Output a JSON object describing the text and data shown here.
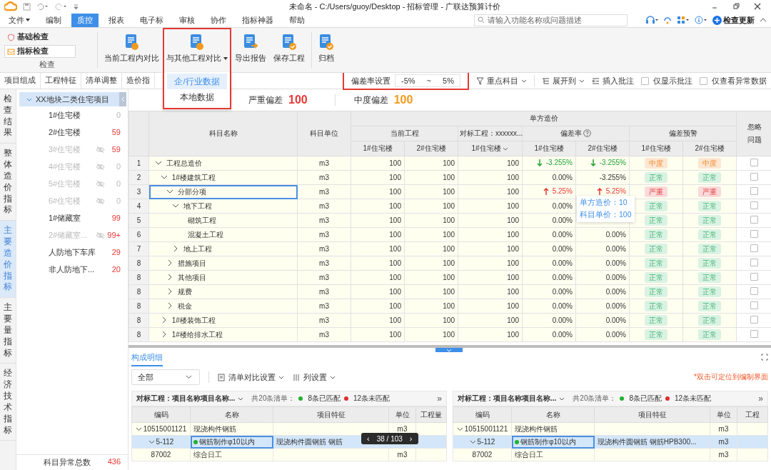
{
  "window": {
    "title": "未命名 - C:/Users/guoy/Desktop - 招标管理 - 广联达预算计价"
  },
  "menu": [
    {
      "label": "文件",
      "dropdown": true,
      "selected": false
    },
    {
      "label": "编制",
      "selected": false
    },
    {
      "label": "质控",
      "selected": true
    },
    {
      "label": "报表",
      "selected": false
    },
    {
      "label": "电子标",
      "selected": false
    },
    {
      "label": "审核",
      "selected": false
    },
    {
      "label": "协作",
      "selected": false
    },
    {
      "label": "指标神器",
      "selected": false
    },
    {
      "label": "帮助",
      "selected": false
    }
  ],
  "search": {
    "placeholder": "请输入功能名称或问题描述"
  },
  "update_button": "检查更新",
  "ribbon": {
    "check_group": {
      "caption": "检查",
      "items": [
        {
          "label": "基础检查",
          "selected": false
        },
        {
          "label": "指标检查",
          "selected": true
        }
      ]
    },
    "buttons": [
      {
        "label": "当前工程内对比"
      },
      {
        "label": "与其他工程对比",
        "dropdown": true,
        "highlighted": true
      },
      {
        "label": "导出报告"
      },
      {
        "label": "保存工程"
      },
      {
        "label": "归档"
      }
    ]
  },
  "compare_menu": {
    "items": [
      {
        "label": "企/行业数据",
        "selected": true
      },
      {
        "label": "本地数据",
        "selected": false
      }
    ]
  },
  "subtabs": [
    "项目组成",
    "工程特征",
    "清单调整",
    "造价指"
  ],
  "toolbar": {
    "deviation": {
      "label": "偏差率设置",
      "min": "-5%",
      "separator": "~",
      "max": "5%",
      "highlighted": true
    },
    "key_subjects": "重点科目",
    "expand_to": "展开到",
    "insert_note": "插入批注",
    "checks": [
      {
        "label": "仅显示批注",
        "checked": false
      },
      {
        "label": "仅查看异常数据",
        "checked": false
      }
    ]
  },
  "vtabs": [
    {
      "label": "检查结果",
      "selected": false
    },
    {
      "label": "整体造价指标",
      "selected": false
    },
    {
      "label": "主要造价指标",
      "selected": true
    },
    {
      "label": "主要量指标",
      "selected": false
    },
    {
      "label": "经济技术指标",
      "selected": false
    }
  ],
  "tree": {
    "root": {
      "label": "XX地块二类住宅项目",
      "expanded": true,
      "children": [
        {
          "label": "1#住宅楼",
          "count": "0",
          "hidden": false,
          "alert": false
        },
        {
          "label": "2#住宅楼",
          "count": "59",
          "hidden": false,
          "alert": true
        },
        {
          "label": "3#住宅楼",
          "count": "59",
          "hidden": true,
          "alert": true
        },
        {
          "label": "4#住宅楼",
          "count": "0",
          "hidden": true,
          "alert": false
        },
        {
          "label": "5#住宅楼",
          "count": "0",
          "hidden": true,
          "alert": false
        },
        {
          "label": "6#住宅楼",
          "count": "0",
          "hidden": true,
          "alert": false
        },
        {
          "label": "1#储藏室",
          "count": "99",
          "hidden": false,
          "alert": true
        },
        {
          "label": "2#储藏室...",
          "count": "99+",
          "hidden": true,
          "alert": true
        },
        {
          "label": "人防地下车库",
          "count": "29",
          "hidden": false,
          "alert": true
        },
        {
          "label": "非人防地下...",
          "count": "20",
          "hidden": false,
          "alert": true
        }
      ]
    },
    "footer": {
      "label": "科目异常总数",
      "count": "436"
    }
  },
  "summary": [
    {
      "label": "严重偏差",
      "value": "100",
      "kind": "severe"
    },
    {
      "label": "中度偏差",
      "value": "100",
      "kind": "moderate"
    }
  ],
  "table": {
    "columns": {
      "name": "科目名称",
      "unit": "科目单位",
      "group": "单方造价",
      "current": "当前工程",
      "benchmark": "对标工程：xxxxxx...",
      "deviation": "偏差率",
      "warning": "偏差预警",
      "ignore": "忽略问题",
      "current_buildings": [
        "1#住宅楼",
        "2#住宅楼"
      ],
      "benchmark_building": "1#住宅楼",
      "deviation_buildings": [
        "1#住宅楼",
        "2#住宅楼"
      ],
      "warning_buildings": [
        "1#住宅楼",
        "2#住宅楼"
      ]
    },
    "tooltip": {
      "lines": [
        "单方造价：10",
        "科目单价：100"
      ]
    },
    "rows": [
      {
        "no": "1",
        "name": "工程总造价",
        "unit": "m3",
        "current": [
          "100",
          "100"
        ],
        "benchmark": "100",
        "deviation": [
          {
            "text": "-3.255%",
            "kind": "down"
          },
          {
            "text": "-3.255%",
            "kind": "down"
          }
        ],
        "warning": [
          {
            "label": "中度",
            "kind": "moderate"
          },
          {
            "label": "中度",
            "kind": "moderate"
          }
        ],
        "ignored": false,
        "selected": false,
        "expanded": true,
        "children": [
          {
            "no": "2",
            "name": "1#楼建筑工程",
            "unit": "m3",
            "current": [
              "100",
              "100"
            ],
            "benchmark": "100",
            "deviation": [
              {
                "text": "0.00%",
                "kind": "none"
              },
              {
                "text": "-3.255%",
                "kind": "none"
              }
            ],
            "warning": [
              {
                "label": "正常",
                "kind": "normal"
              },
              {
                "label": "正常",
                "kind": "normal"
              }
            ],
            "ignored": false,
            "selected": false,
            "expanded": true,
            "children": [
              {
                "no": "3",
                "name": "分部分项",
                "unit": "m3",
                "current": [
                  "100",
                  "100"
                ],
                "benchmark": "100",
                "deviation": [
                  {
                    "text": "5.25%",
                    "kind": "up"
                  },
                  {
                    "text": "5.25%",
                    "kind": "up"
                  }
                ],
                "warning": [
                  {
                    "label": "严重",
                    "kind": "severe"
                  },
                  {
                    "label": "严重",
                    "kind": "severe"
                  }
                ],
                "ignored": false,
                "selected": true,
                "expanded": true,
                "children": [
                  {
                    "no": "4",
                    "name": "地下工程",
                    "unit": "m3",
                    "current": [
                      "100",
                      "100"
                    ],
                    "benchmark": "100",
                    "deviation": [
                      {
                        "text": "0.00%",
                        "kind": "none"
                      }
                    ],
                    "warning": [
                      {
                        "label": "正常",
                        "kind": "normal"
                      },
                      {
                        "label": "正常",
                        "kind": "normal"
                      }
                    ],
                    "ignored": false,
                    "selected": false,
                    "expanded": true,
                    "children": [
                      {
                        "no": "5",
                        "name": "砌筑工程",
                        "unit": "m3",
                        "current": [
                          "100",
                          "100"
                        ],
                        "benchmark": "100",
                        "deviation": [
                          {
                            "text": "0.00%",
                            "kind": "none"
                          }
                        ],
                        "warning": [
                          {
                            "label": "正常",
                            "kind": "normal"
                          },
                          {
                            "label": "正常",
                            "kind": "normal"
                          }
                        ],
                        "ignored": false,
                        "selected": false
                      },
                      {
                        "no": "6",
                        "name": "混凝土工程",
                        "unit": "m3",
                        "current": [
                          "100",
                          "100"
                        ],
                        "benchmark": "100",
                        "deviation": [
                          {
                            "text": "0.00%",
                            "kind": "none"
                          },
                          {
                            "text": "0.00%",
                            "kind": "none"
                          }
                        ],
                        "warning": [
                          {
                            "label": "正常",
                            "kind": "normal"
                          },
                          {
                            "label": "正常",
                            "kind": "normal"
                          }
                        ],
                        "ignored": false,
                        "selected": false
                      }
                    ]
                  },
                  {
                    "no": "7",
                    "name": "地上工程",
                    "unit": "m3",
                    "current": [
                      "100",
                      "100"
                    ],
                    "benchmark": "100",
                    "deviation": [
                      {
                        "text": "0.00%",
                        "kind": "none"
                      },
                      {
                        "text": "0.00%",
                        "kind": "none"
                      }
                    ],
                    "warning": [
                      {
                        "label": "正常",
                        "kind": "normal"
                      },
                      {
                        "label": "正常",
                        "kind": "normal"
                      }
                    ],
                    "ignored": false,
                    "selected": false,
                    "expanded": false
                  }
                ]
              },
              {
                "no": "8",
                "name": "措施项目",
                "unit": "m3",
                "current": [
                  "100",
                  "100"
                ],
                "benchmark": "100",
                "deviation": [
                  {
                    "text": "0.00%",
                    "kind": "none"
                  },
                  {
                    "text": "0.00%",
                    "kind": "none"
                  }
                ],
                "warning": [
                  {
                    "label": "正常",
                    "kind": "normal"
                  },
                  {
                    "label": "正常",
                    "kind": "normal"
                  }
                ],
                "ignored": false,
                "selected": false,
                "expanded": false
              },
              {
                "no": "8",
                "name": "其他项目",
                "unit": "m3",
                "current": [
                  "100",
                  "100"
                ],
                "benchmark": "100",
                "deviation": [
                  {
                    "text": "0.00%",
                    "kind": "none"
                  },
                  {
                    "text": "0.00%",
                    "kind": "none"
                  }
                ],
                "warning": [
                  {
                    "label": "正常",
                    "kind": "normal"
                  },
                  {
                    "label": "正常",
                    "kind": "normal"
                  }
                ],
                "ignored": false,
                "selected": false,
                "expanded": false
              },
              {
                "no": "8",
                "name": "规费",
                "unit": "m3",
                "current": [
                  "100",
                  "100"
                ],
                "benchmark": "100",
                "deviation": [
                  {
                    "text": "0.00%",
                    "kind": "none"
                  },
                  {
                    "text": "0.00%",
                    "kind": "none"
                  }
                ],
                "warning": [
                  {
                    "label": "正常",
                    "kind": "normal"
                  },
                  {
                    "label": "正常",
                    "kind": "normal"
                  }
                ],
                "ignored": false,
                "selected": false,
                "expanded": false
              },
              {
                "no": "8",
                "name": "税金",
                "unit": "m3",
                "current": [
                  "100",
                  "100"
                ],
                "benchmark": "100",
                "deviation": [
                  {
                    "text": "0.00%",
                    "kind": "none"
                  },
                  {
                    "text": "0.00%",
                    "kind": "none"
                  }
                ],
                "warning": [
                  {
                    "label": "正常",
                    "kind": "normal"
                  },
                  {
                    "label": "正常",
                    "kind": "normal"
                  }
                ],
                "ignored": false,
                "selected": false,
                "expanded": false
              }
            ]
          },
          {
            "no": "8",
            "name": "1#楼装饰工程",
            "unit": "m3",
            "current": [
              "100",
              "100"
            ],
            "benchmark": "100",
            "deviation": [
              {
                "text": "0.00%",
                "kind": "none"
              },
              {
                "text": "0.00%",
                "kind": "none"
              }
            ],
            "warning": [
              {
                "label": "正常",
                "kind": "normal"
              },
              {
                "label": "正常",
                "kind": "normal"
              }
            ],
            "ignored": false,
            "selected": false,
            "expanded": false
          },
          {
            "no": "8",
            "name": "1#楼给排水工程",
            "unit": "m3",
            "current": [
              "100",
              "100"
            ],
            "benchmark": "100",
            "deviation": [
              {
                "text": "0.00%",
                "kind": "none"
              },
              {
                "text": "0.00%",
                "kind": "none"
              }
            ],
            "warning": [
              {
                "label": "正常",
                "kind": "normal"
              },
              {
                "label": "正常",
                "kind": "normal"
              }
            ],
            "ignored": false,
            "selected": false,
            "expanded": false
          }
        ]
      }
    ]
  },
  "detail": {
    "tab": "构成明细",
    "filter": "全部",
    "settings": [
      "清单对比设置",
      "列设置"
    ],
    "hint": "*双击可定位到编制界面",
    "pager": {
      "prev": "‹",
      "text": "38 / 103",
      "next": "›"
    },
    "panes": [
      {
        "benchmark": "对标工程：项目名称项目名称...",
        "total": "共20条清单：",
        "matched": "8条已匹配",
        "unmatched": "12条未匹配",
        "more": "»",
        "columns": [
          "编码",
          "名称",
          "项目特征",
          "单位",
          "工程量"
        ],
        "pager": true,
        "rows": [
          {
            "code": "10515001121",
            "name": "现浇构件钢筋",
            "unit": "m3",
            "expanded": true,
            "selected": false
          },
          {
            "code": "5-112",
            "name": "钢筋制作φ10以内",
            "feature": "现浇构件圆钢筋 钢筋",
            "kind": "matched",
            "expanded": true,
            "selected": true
          },
          {
            "code": "87002",
            "name": "综合日工",
            "unit": "m3",
            "selected": false
          }
        ]
      },
      {
        "benchmark": "对标工程：项目名称项目名称...",
        "total": "共20条清单：",
        "matched": "8条已匹配",
        "unmatched": "12条未匹配",
        "more": "»",
        "columns": [
          "编码",
          "名称",
          "项目特征",
          "单位",
          "工程"
        ],
        "rows": [
          {
            "code": "10515001121",
            "name": "现浇构件钢筋",
            "unit": "m3",
            "expanded": true,
            "selected": false
          },
          {
            "code": "5-112",
            "name": "钢筋制作φ10以内",
            "feature": "现浇构件圆钢筋 钢筋HPB300...",
            "unit": "m3",
            "kind": "matched",
            "expanded": true,
            "selected": true
          },
          {
            "code": "87002",
            "name": "综合日工",
            "unit": "m3",
            "selected": false
          }
        ]
      }
    ]
  }
}
